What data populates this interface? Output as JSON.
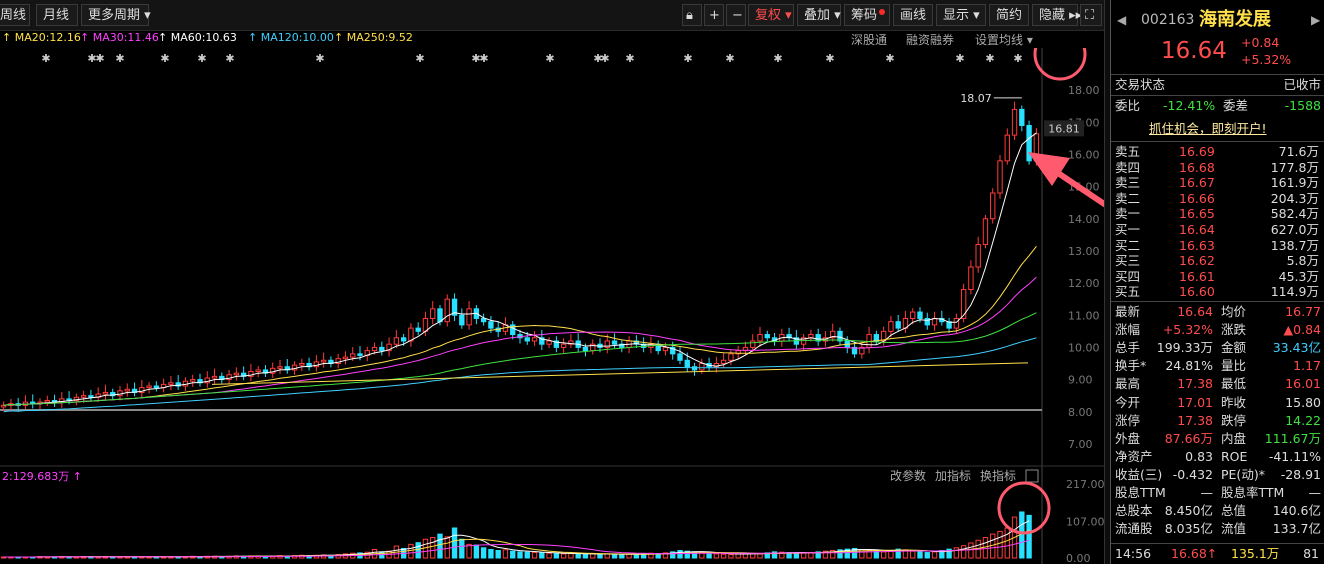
{
  "toolbar": {
    "period_left": "周线",
    "period_month": "月线",
    "more_periods": "更多周期",
    "fq": "复权",
    "overlay": "叠加",
    "chips": "筹码",
    "draw": "画线",
    "display": "显示",
    "simple": "简约",
    "hide": "隐藏"
  },
  "ma_legend": [
    {
      "label": "MA20:12.16",
      "color": "#ffe04a"
    },
    {
      "label": "MA30:11.46",
      "color": "#ff40ff"
    },
    {
      "label": "MA60:10.63",
      "color": "#ffffff"
    },
    {
      "label": "MA120:10.00",
      "color": "#3fd0ff"
    },
    {
      "label": "MA250:9.52",
      "color": "#ffe04a"
    }
  ],
  "top_links": {
    "sgt": "深股通",
    "rzrq": "融资融券",
    "ma_set": "设置均线"
  },
  "price_axis": [
    "18.00",
    "17.00",
    "16.00",
    "15.00",
    "14.00",
    "13.00",
    "12.00",
    "11.00",
    "10.00",
    "9.00",
    "8.00",
    "7.00"
  ],
  "current_price_tag": "16.81",
  "high_marker": "18.07",
  "volume": {
    "legend": "2:129.683万",
    "links": {
      "params": "改参数",
      "add": "加指标",
      "swap": "换指标"
    },
    "axis": [
      "217.00",
      "107.00",
      "0.00"
    ]
  },
  "colors": {
    "up": "#ff3a3a",
    "down": "#28e0ff",
    "grid": "#333333",
    "annot": "#ff5a6e"
  },
  "quote": {
    "code": "002163",
    "name": "海南发展",
    "price": "16.64",
    "change": "+0.84",
    "change_pct": "+5.32%",
    "trade_state_label": "交易状态",
    "trade_state": "已收市",
    "weibi_label": "委比",
    "weibi": "-12.41%",
    "weicha_label": "委差",
    "weicha": "-1588",
    "ad": "抓住机会，即刻开户!",
    "sell": [
      {
        "label": "卖五",
        "price": "16.69",
        "vol": "71.6万"
      },
      {
        "label": "卖四",
        "price": "16.68",
        "vol": "177.8万"
      },
      {
        "label": "卖三",
        "price": "16.67",
        "vol": "161.9万"
      },
      {
        "label": "卖二",
        "price": "16.66",
        "vol": "204.3万"
      },
      {
        "label": "卖一",
        "price": "16.65",
        "vol": "582.4万"
      }
    ],
    "buy": [
      {
        "label": "买一",
        "price": "16.64",
        "vol": "627.0万"
      },
      {
        "label": "买二",
        "price": "16.63",
        "vol": "138.7万"
      },
      {
        "label": "买三",
        "price": "16.62",
        "vol": "5.8万"
      },
      {
        "label": "买四",
        "price": "16.61",
        "vol": "45.3万"
      },
      {
        "label": "买五",
        "price": "16.60",
        "vol": "114.9万"
      }
    ],
    "stats": [
      [
        {
          "l": "最新",
          "v": "16.64",
          "c": "red"
        },
        {
          "l": "均价",
          "v": "16.77",
          "c": "red"
        }
      ],
      [
        {
          "l": "涨幅",
          "v": "+5.32%",
          "c": "red"
        },
        {
          "l": "涨跌",
          "v": "▲0.84",
          "c": "red"
        }
      ],
      [
        {
          "l": "总手",
          "v": "199.33万",
          "c": "wht"
        },
        {
          "l": "金额",
          "v": "33.43亿",
          "c": "cyan"
        }
      ],
      [
        {
          "l": "换手*",
          "v": "24.81%",
          "c": "wht"
        },
        {
          "l": "量比",
          "v": "1.17",
          "c": "red"
        }
      ],
      [
        {
          "l": "最高",
          "v": "17.38",
          "c": "red"
        },
        {
          "l": "最低",
          "v": "16.01",
          "c": "red"
        }
      ],
      [
        {
          "l": "今开",
          "v": "17.01",
          "c": "red"
        },
        {
          "l": "昨收",
          "v": "15.80",
          "c": "wht"
        }
      ],
      [
        {
          "l": "涨停",
          "v": "17.38",
          "c": "red"
        },
        {
          "l": "跌停",
          "v": "14.22",
          "c": "grn"
        }
      ],
      [
        {
          "l": "外盘",
          "v": "87.66万",
          "c": "red"
        },
        {
          "l": "内盘",
          "v": "111.67万",
          "c": "grn"
        }
      ],
      [
        {
          "l": "净资产",
          "v": "0.83",
          "c": "wht"
        },
        {
          "l": "ROE",
          "v": "-41.11%",
          "c": "wht"
        }
      ],
      [
        {
          "l": "收益(三)",
          "v": "-0.432",
          "c": "wht"
        },
        {
          "l": "PE(动)*",
          "v": "-28.91",
          "c": "wht"
        }
      ],
      [
        {
          "l": "股息TTM",
          "v": "—",
          "c": "wht"
        },
        {
          "l": "股息率TTM",
          "v": "—",
          "c": "wht"
        }
      ],
      [
        {
          "l": "总股本",
          "v": "8.450亿",
          "c": "wht"
        },
        {
          "l": "总值",
          "v": "140.6亿",
          "c": "wht"
        }
      ],
      [
        {
          "l": "流通股",
          "v": "8.035亿",
          "c": "wht"
        },
        {
          "l": "流值",
          "v": "133.7亿",
          "c": "wht"
        }
      ]
    ],
    "tick": {
      "time": "14:56",
      "price": "16.68↑",
      "vol": "135.1万",
      "num": "81"
    }
  },
  "chart_data": {
    "type": "candlestick",
    "title": "",
    "ylim": [
      6.5,
      18.5
    ],
    "closes": [
      8.2,
      8.25,
      8.2,
      8.3,
      8.25,
      8.3,
      8.35,
      8.3,
      8.4,
      8.35,
      8.45,
      8.5,
      8.45,
      8.55,
      8.6,
      8.5,
      8.65,
      8.7,
      8.6,
      8.75,
      8.8,
      8.75,
      8.85,
      8.9,
      8.8,
      8.95,
      9.0,
      8.9,
      9.05,
      9.1,
      9.0,
      9.15,
      9.2,
      9.1,
      9.25,
      9.3,
      9.2,
      9.35,
      9.4,
      9.3,
      9.45,
      9.5,
      9.4,
      9.55,
      9.6,
      9.5,
      9.65,
      9.7,
      9.8,
      9.75,
      9.9,
      10.0,
      9.9,
      10.1,
      10.3,
      10.2,
      10.6,
      10.5,
      10.9,
      11.2,
      10.8,
      11.5,
      11.0,
      10.7,
      11.2,
      10.9,
      10.8,
      10.6,
      10.5,
      10.7,
      10.4,
      10.3,
      10.2,
      10.3,
      10.1,
      10.2,
      10.0,
      10.1,
      10.2,
      10.0,
      9.9,
      10.1,
      10.0,
      10.2,
      10.1,
      10.0,
      10.2,
      10.1,
      10.0,
      10.1,
      9.9,
      10.0,
      9.8,
      9.6,
      9.4,
      9.3,
      9.5,
      9.4,
      9.5,
      9.6,
      9.8,
      9.9,
      10.0,
      10.2,
      10.4,
      10.3,
      10.2,
      10.4,
      10.3,
      10.1,
      10.3,
      10.4,
      10.2,
      10.3,
      10.5,
      10.2,
      10.0,
      9.8,
      10.0,
      10.4,
      10.2,
      10.5,
      10.8,
      10.6,
      10.9,
      11.1,
      10.9,
      10.7,
      10.9,
      10.8,
      10.6,
      10.9,
      11.8,
      12.5,
      13.2,
      14.0,
      14.8,
      15.8,
      16.6,
      17.4,
      16.9,
      15.8,
      16.64
    ],
    "volumes": [
      3,
      3,
      3,
      3,
      3,
      4,
      3,
      3,
      4,
      3,
      3,
      4,
      4,
      3,
      4,
      3,
      4,
      4,
      3,
      4,
      4,
      3,
      4,
      4,
      3,
      4,
      5,
      4,
      5,
      5,
      4,
      5,
      6,
      5,
      6,
      6,
      5,
      6,
      7,
      6,
      7,
      8,
      7,
      8,
      9,
      8,
      10,
      12,
      14,
      15,
      17,
      25,
      18,
      20,
      35,
      28,
      40,
      45,
      55,
      60,
      70,
      62,
      88,
      55,
      40,
      38,
      30,
      25,
      22,
      24,
      20,
      18,
      17,
      16,
      15,
      14,
      13,
      12,
      13,
      12,
      11,
      12,
      11,
      12,
      11,
      10,
      11,
      10,
      12,
      14,
      13,
      15,
      18,
      22,
      20,
      18,
      16,
      14,
      12,
      11,
      10,
      12,
      14,
      13,
      12,
      15,
      18,
      17,
      16,
      15,
      14,
      16,
      18,
      20,
      22,
      24,
      26,
      28,
      25,
      22,
      20,
      18,
      22,
      26,
      24,
      20,
      18,
      16,
      18,
      22,
      26,
      30,
      36,
      44,
      52,
      60,
      70,
      78,
      88,
      120,
      135,
      125
    ],
    "vol_ylim": [
      0,
      217
    ]
  }
}
